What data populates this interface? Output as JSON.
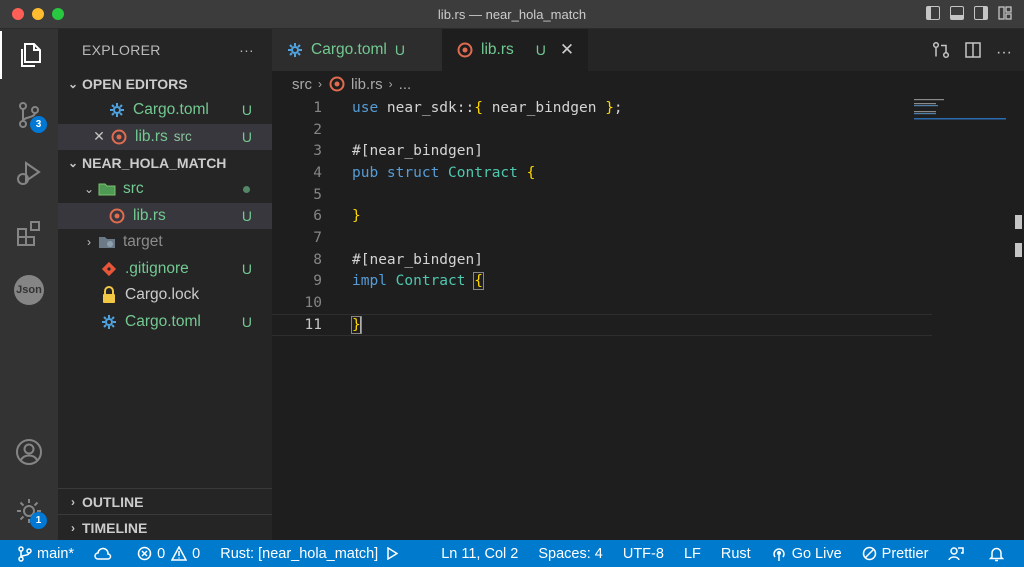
{
  "window": {
    "title": "lib.rs — near_hola_match"
  },
  "activity_bar": {
    "scm_badge": "3",
    "accounts_badge": "1",
    "json_label": "Json"
  },
  "sidebar": {
    "header": "EXPLORER",
    "more": "···",
    "open_editors": {
      "title": "OPEN EDITORS",
      "items": [
        {
          "name": "Cargo.toml",
          "status": "U"
        },
        {
          "name": "lib.rs",
          "desc": "src",
          "status": "U"
        }
      ]
    },
    "project": {
      "title": "NEAR_HOLA_MATCH",
      "items": [
        {
          "name": "src"
        },
        {
          "name": "lib.rs",
          "status": "U"
        },
        {
          "name": "target"
        },
        {
          "name": ".gitignore",
          "status": "U"
        },
        {
          "name": "Cargo.lock"
        },
        {
          "name": "Cargo.toml",
          "status": "U"
        }
      ]
    },
    "outline": "OUTLINE",
    "timeline": "TIMELINE"
  },
  "tabs": [
    {
      "label": "Cargo.toml",
      "status": "U"
    },
    {
      "label": "lib.rs",
      "status": "U",
      "close": "✕"
    }
  ],
  "breadcrumb": {
    "folder": "src",
    "file": "lib.rs",
    "more": "..."
  },
  "editor": {
    "line_numbers": [
      "1",
      "2",
      "3",
      "4",
      "5",
      "6",
      "7",
      "8",
      "9",
      "10",
      "11"
    ],
    "lines": {
      "l1": {
        "kw": "use",
        "path": " near_sdk::",
        "open": "{",
        "mid": " near_bindgen ",
        "close": "}",
        "end": ";"
      },
      "l3": "#[near_bindgen]",
      "l4": {
        "kw": "pub struct",
        "ty": "Contract",
        "br": "{"
      },
      "l6": "}",
      "l8": "#[near_bindgen]",
      "l9": {
        "kw": "impl",
        "ty": "Contract",
        "br": "{"
      },
      "l11": "}"
    }
  },
  "status_bar": {
    "branch": "main*",
    "errors": "0",
    "warnings": "0",
    "rust": "Rust: [near_hola_match]",
    "position": "Ln 11, Col 2",
    "spaces": "Spaces: 4",
    "encoding": "UTF-8",
    "eol": "LF",
    "language": "Rust",
    "go_live": "Go Live",
    "prettier": "Prettier"
  },
  "colors": {
    "accent": "#007acc",
    "untracked": "#73c991",
    "rust_icon": "#e06c50",
    "toml_icon": "#4fa3e0",
    "folder_icon": "#7cc36e"
  }
}
